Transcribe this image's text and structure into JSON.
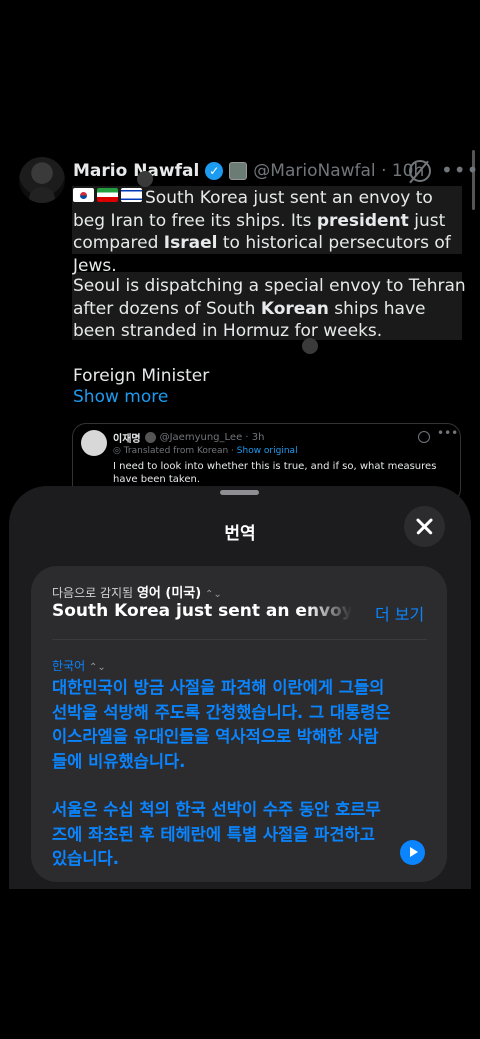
{
  "tweet": {
    "name": "Mario Nawfal",
    "handle": "@MarioNawfal · 10h",
    "flags": [
      "south-korea-flag",
      "iran-flag",
      "israel-flag"
    ],
    "paragraph1_parts": [
      "South Korea just sent an envoy to beg Iran to free its ships. Its ",
      "president",
      " just compared ",
      "Israel",
      " to historical persecutors of Jews."
    ],
    "paragraph2_parts": [
      "Seoul is dispatching a special envoy to Tehran after dozens of South ",
      "Korean",
      " ships have been stranded in Hormuz for weeks."
    ],
    "paragraph3": "Foreign Minister",
    "show_more": "Show more"
  },
  "quoted": {
    "name": "이재명",
    "handle": "@Jaemyung_Lee · 3h",
    "translated_label": "Translated from Korean",
    "show_original": "Show original",
    "text": "I need to look into whether this is true, and if so, what measures have been taken."
  },
  "sheet": {
    "title": "번역",
    "source_label_prefix": "다음으로 감지됨",
    "source_language": "영어 (미국)",
    "source_text": "South Korea just sent an envoy to beg",
    "see_more": "더 보기",
    "target_language": "한국어",
    "target_paragraph1": "대한민국이 방금 사절을 파견해 이란에게 그들의 선박을 석방해 주도록 간청했습니다. 그 대통령은 이스라엘을 유대인들을 역사적으로 박해한 사람들에 비유했습니다.",
    "target_paragraph2": "서울은 수십 척의 한국 선박이 수주 동안 호르무즈에 좌초된 후 테헤란에 특별 사절을 파견하고 있습니다."
  },
  "colors": {
    "accent": "#0a84ff",
    "link": "#1d9bf0",
    "background": "#000000",
    "sheet": "#1c1c1e"
  }
}
